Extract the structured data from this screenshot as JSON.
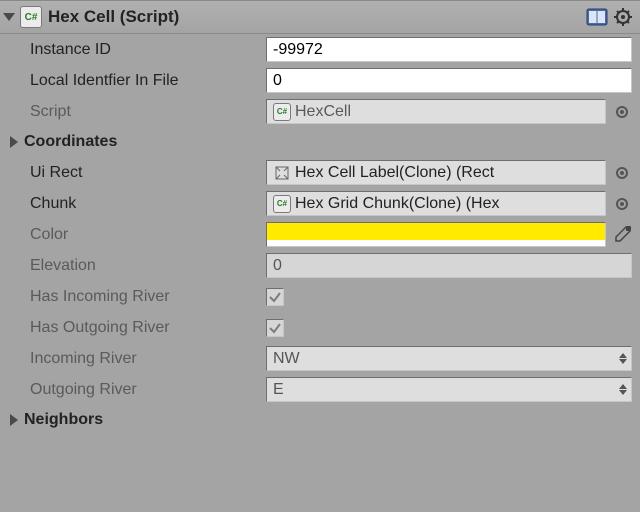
{
  "header": {
    "title": "Hex Cell (Script)",
    "chip": "C#"
  },
  "fields": {
    "instanceId": {
      "label": "Instance ID",
      "value": "-99972"
    },
    "localId": {
      "label": "Local Identfier In File",
      "value": "0"
    },
    "script": {
      "label": "Script",
      "value": "HexCell"
    },
    "coordinates": {
      "label": "Coordinates"
    },
    "uiRect": {
      "label": "Ui Rect",
      "value": "Hex Cell Label(Clone) (Rect"
    },
    "chunk": {
      "label": "Chunk",
      "value": "Hex Grid Chunk(Clone) (Hex"
    },
    "color": {
      "label": "Color",
      "hex": "#ffea00"
    },
    "elevation": {
      "label": "Elevation",
      "value": "0"
    },
    "hasIn": {
      "label": "Has Incoming River"
    },
    "hasOut": {
      "label": "Has Outgoing River"
    },
    "inDir": {
      "label": "Incoming River",
      "value": "NW"
    },
    "outDir": {
      "label": "Outgoing River",
      "value": "E"
    },
    "neighbors": {
      "label": "Neighbors"
    }
  }
}
